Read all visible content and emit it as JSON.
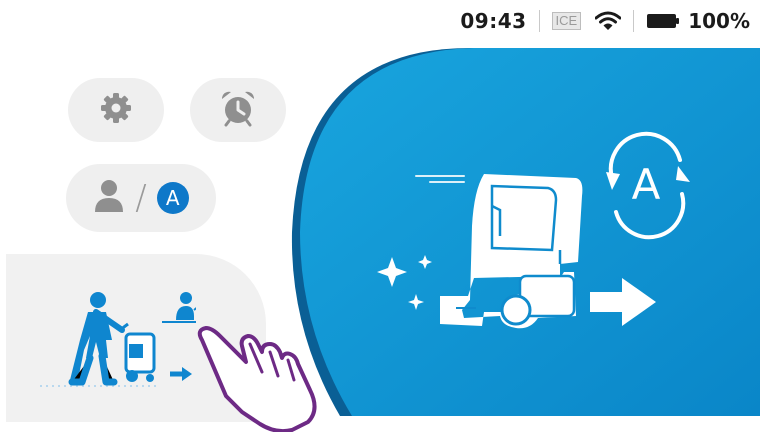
{
  "status_bar": {
    "time": "09:43",
    "ice_label": "ICE",
    "wifi_icon": "wifi-icon",
    "battery_icon": "battery-icon",
    "battery_percent": "100%"
  },
  "buttons": {
    "settings_icon": "gear-icon",
    "alarm_icon": "alarm-clock-icon",
    "user_mode": {
      "user_icon": "user-icon",
      "separator": "/",
      "auto_badge": "A"
    }
  },
  "tiles": {
    "manual_mode_icon": "person-pushing-scrubber-icon",
    "auto_mode_icon": "autonomous-scrubber-icon",
    "auto_badge": "A"
  },
  "colors": {
    "accent_blue": "#1a9fd9",
    "accent_blue_dark": "#0e78c9",
    "pill_gray": "#efefef",
    "icon_gray": "#8f8f8f",
    "hand_outline": "#7b2f8f"
  }
}
